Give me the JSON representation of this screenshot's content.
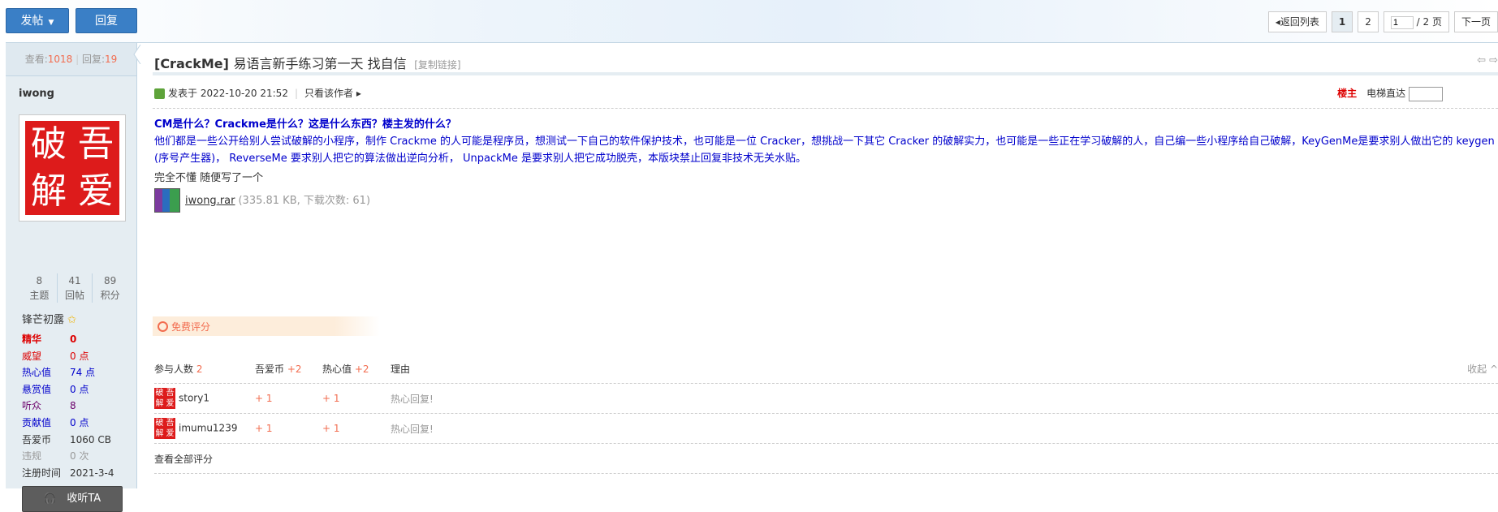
{
  "toolbar": {
    "post_label": "发帖",
    "reply_label": "回复"
  },
  "pager": {
    "back": "返回列表",
    "pages": [
      "1",
      "2"
    ],
    "current": "1",
    "total": "/ 2 页",
    "next": "下一页"
  },
  "stats": {
    "views_label": "查看:",
    "views": "1018",
    "replies_label": "回复:",
    "replies": "19"
  },
  "user": {
    "name": "iwong",
    "avatar_chars": [
      "破",
      "吾",
      "解",
      "爱"
    ],
    "counts": [
      {
        "value": "8",
        "label": "主题"
      },
      {
        "value": "41",
        "label": "回帖"
      },
      {
        "value": "89",
        "label": "积分"
      }
    ],
    "rank": "锋芒初露",
    "info": [
      {
        "key": "精华",
        "value": "0",
        "color": "#dd0000",
        "bold": true
      },
      {
        "key": "威望",
        "value": "0 点",
        "color": "#dd0000",
        "bold": false
      },
      {
        "key": "热心值",
        "value": "74 点",
        "color": "#0000cc",
        "bold": false
      },
      {
        "key": "悬赏值",
        "value": "0 点",
        "color": "#0000cc",
        "bold": false
      },
      {
        "key": "听众",
        "value": "8",
        "color": "#6b006b",
        "bold": false
      },
      {
        "key": "贡献值",
        "value": "0 点",
        "color": "#0000cc",
        "bold": false
      },
      {
        "key": "吾爱币",
        "value": "1060 CB",
        "color": "#333333",
        "bold": false
      },
      {
        "key": "违规",
        "value": "0 次",
        "color": "#999999",
        "bold": false
      },
      {
        "key": "注册时间",
        "value": "2021-3-4",
        "color": "#333333",
        "bold": false
      }
    ],
    "listen_label": "收听TA"
  },
  "post": {
    "title_prefix": "[CrackMe]",
    "title": "易语言新手练习第一天 找自信",
    "copy_link": "[复制链接]",
    "posted_at": "发表于 2022-10-20 21:52",
    "author_only": "只看该作者",
    "louzhu": "楼主",
    "elevator": "电梯直达",
    "question": "CM是什么？Crackme是什么？这是什么东西？楼主发的什么？",
    "explanation": "他们都是一些公开给别人尝试破解的小程序，制作 Crackme 的人可能是程序员，想测试一下自己的软件保护技术，也可能是一位 Cracker，想挑战一下其它 Cracker 的破解实力，也可能是一些正在学习破解的人，自己编一些小程序给自己破解，KeyGenMe是要求别人做出它的 keygen (序号产生器)， ReverseMe 要求别人把它的算法做出逆向分析， UnpackMe 是要求别人把它成功脱壳，本版块禁止回复非技术无关水贴。",
    "body": "完全不懂 随便写了一个",
    "attachment": {
      "name": "iwong.rar",
      "meta": "(335.81 KB, 下载次数: 61)"
    }
  },
  "rating": {
    "label": "免费评分",
    "headers": {
      "participants": "参与人数",
      "participants_count": "2",
      "coin": "吾爱币",
      "coin_total": "+2",
      "heart": "热心值",
      "heart_total": "+2",
      "reason": "理由"
    },
    "collapse": "收起",
    "rows": [
      {
        "user": "story1",
        "coin": "+ 1",
        "heart": "+ 1",
        "reason": "热心回复!"
      },
      {
        "user": "imumu1239",
        "coin": "+ 1",
        "heart": "+ 1",
        "reason": "热心回复!"
      }
    ],
    "view_all": "查看全部评分"
  }
}
